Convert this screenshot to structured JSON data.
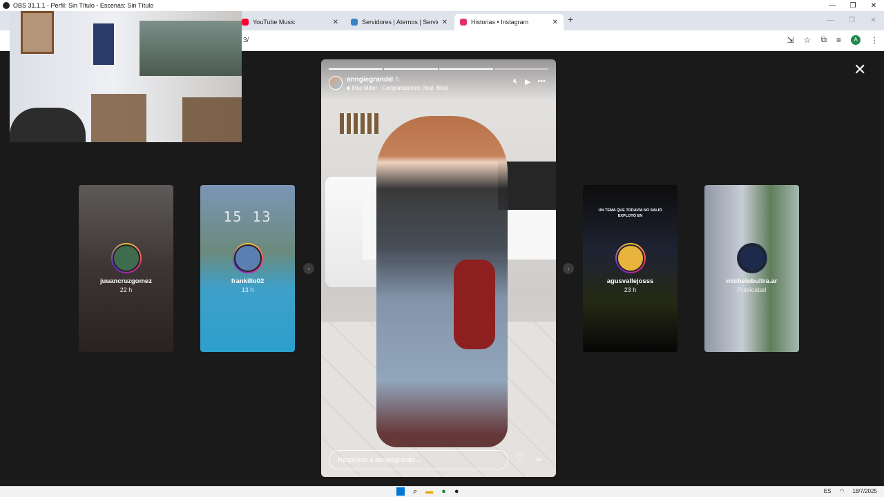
{
  "obs": {
    "title": "OBS 31.1.1 - Perfil: Sin Título - Escenas: Sin Título",
    "minimize": "—",
    "restore": "❐",
    "close": "✕"
  },
  "browser": {
    "tabs": [
      {
        "label": "YouTube Music",
        "favicon_color": "#ff0033"
      },
      {
        "label": "Servidores | Aternos | Servidor de Minecraft",
        "favicon_color": "#3b82c4"
      },
      {
        "label": "Historias • Instagram",
        "favicon_color": "#e1306c"
      }
    ],
    "tab_close": "✕",
    "new_tab": "+",
    "url_fragment": "3/",
    "avatar_initial": "A"
  },
  "story": {
    "username": "anngiegrande",
    "time": "3 h",
    "music_bars": "ııı",
    "music": "Mac Miller · Congratulations (feat. Bilal)",
    "progress_segments": 4,
    "progress_done": 3,
    "reply_placeholder": "Responde a anngiegrande...",
    "icons": {
      "mute": "muted-speaker-icon",
      "play": "play-icon",
      "more": "more-options-icon",
      "like": "heart-icon",
      "send": "send-icon"
    }
  },
  "preview_cards": [
    {
      "username": "juuancruzgomez",
      "time": "22 h"
    },
    {
      "username": "frankillo02",
      "time": "13 h",
      "overlay": "15 13"
    },
    {
      "username": "agusvallejosss",
      "time": "23 h",
      "overlay": "UN TEMA QUE TODAVÍA NO SALIÓ EXPLOTÓ EN"
    },
    {
      "username": "michelobultra.ar",
      "time": "Publicidad"
    }
  ],
  "taskbar": {
    "language": "ES",
    "date": "18/7/2025"
  },
  "colors": {
    "stage_bg": "#1a1a1a",
    "instagram_accent": "#e1306c",
    "chrome_tabstrip": "#dfe3eb"
  }
}
